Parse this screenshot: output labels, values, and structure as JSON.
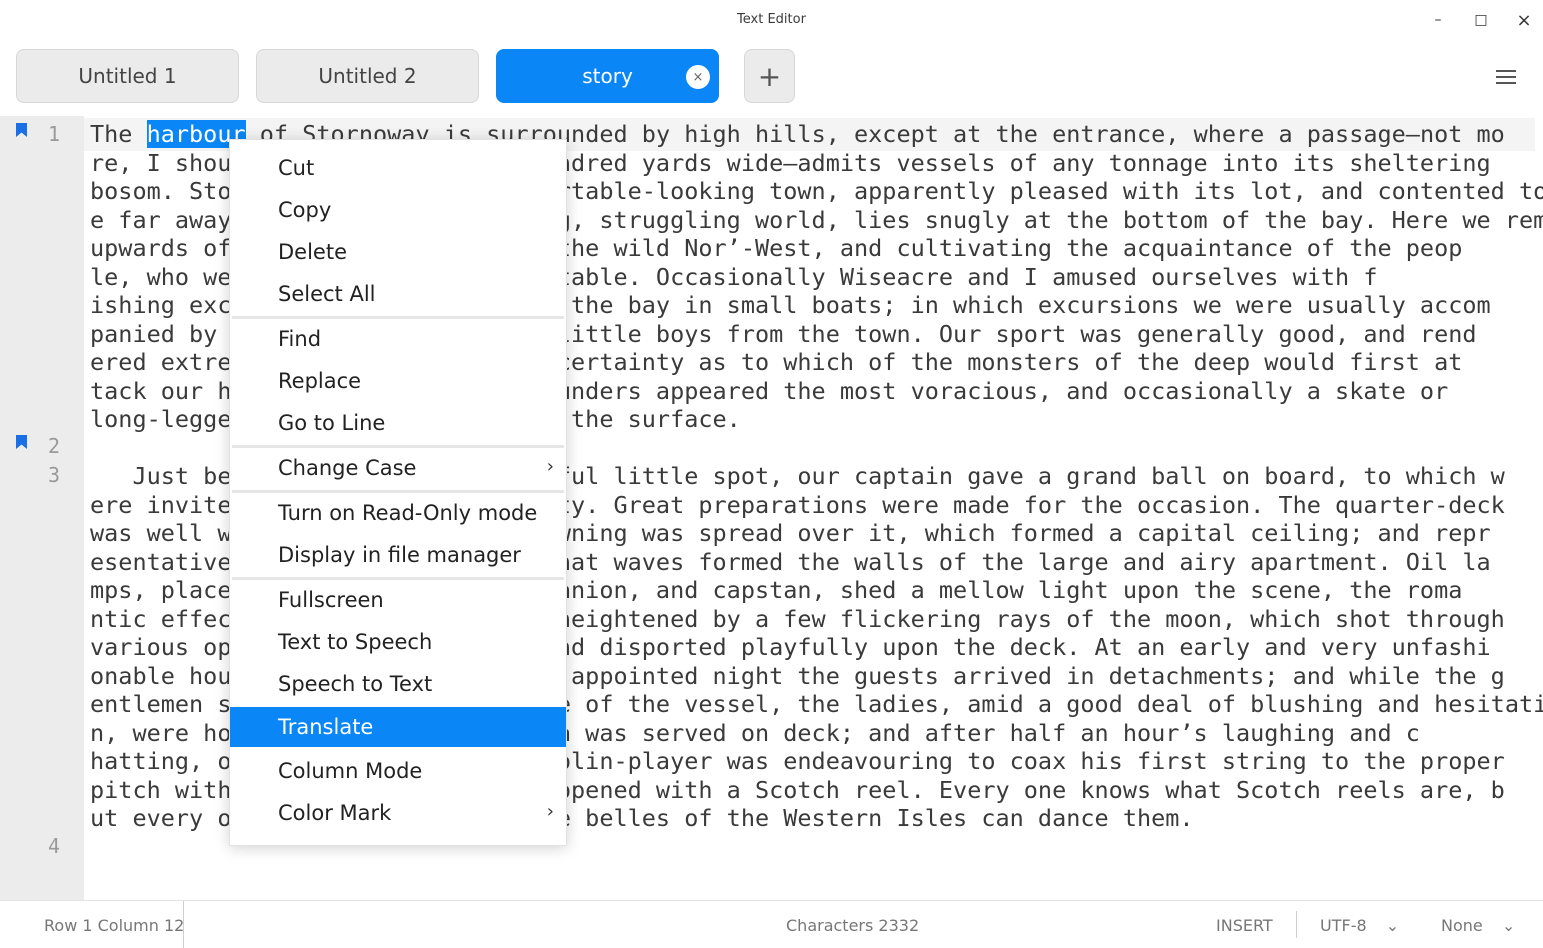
{
  "window": {
    "title": "Text Editor",
    "minimize": "–",
    "maximize": "□",
    "close": "×"
  },
  "tabs": [
    {
      "label": "Untitled 1"
    },
    {
      "label": "Untitled 2"
    },
    {
      "label": "story",
      "active": true,
      "close": "×"
    }
  ],
  "toolbar": {
    "new_tab": "+"
  },
  "editor": {
    "line_numbers": [
      "1",
      "2",
      "3",
      "4"
    ],
    "bookmarked_lines": [
      "1",
      "2"
    ],
    "selected_word": "harbour",
    "lines": [
      "The ",
      " of Stornoway is surrounded by high hills, except at the entrance, where a passage—not mo\nre, I should think, than a few hundred yards wide—admits vessels of any tonnage into its sheltering\nbosom. Stornoway is a neat, comfortable-looking town, apparently pleased with its lot, and contented to b\ne far away from the great bustling, struggling world, lies snugly at the bottom of the bay. Here we remained\nupwards of a week, preparing for the wild Nor’-West, and cultivating the acquaintance of the peop\nle, who we found to be very hospitable. Occasionally Wiseacre and I amused ourselves with f\nishing excursions to the mouth of the bay in small boats; in which excursions we were usually accom\npanied by two or three hardy old little boys from the town. Our sport was generally good, and rend\nered extremely exciting by the uncertainty as to which of the monsters of the deep would first at\ntack our hooks. Flat-fish and flounders appeared the most voracious, and occasionally a skate or\nlong-legged crab would come up to the surface.\n\n   Just before we left this cheerful little spot, our captain gave a grand ball on board, to which w\nere invited all the rank and beauty. Great preparations were made for the occasion. The quarter-deck\nwas well washed, and a spacious awning was spread over it, which formed a capital ceiling; and repr\nesentative flags of all nations that waves formed the walls of the large and airy apartment. Oil la\nmps, placed on the binnacle, companion, and capstan, shed a mellow light upon the scene, the roma\nntic effect of which was greatly heightened by a few flickering rays of the moon, which shot through\nvarious openings in the awning, and disported playfully upon the deck. At an early and very unfashi\nonable hour on the evening of the appointed night the guests arrived in detachments; and while the g\nentlemen stood smoking on the side of the vessel, the ladies, amid a good deal of blushing and hesitatio\nn, were hoisted up in a chair. Tea was served on deck; and after half an hour’s laughing and c\nhatting, our fiddler—a capital violin-player was endeavouring to coax his first string to the proper\npitch with the pipe—and the ball opened with a Scotch reel. Every one knows what Scotch reels are, b\nut every one does not know how the belles of the Western Isles can dance them."
    ]
  },
  "context_menu": {
    "items": [
      {
        "label": "Cut"
      },
      {
        "label": "Copy"
      },
      {
        "label": "Delete"
      },
      {
        "label": "Select All"
      },
      {
        "label": "Find"
      },
      {
        "label": "Replace"
      },
      {
        "label": "Go to Line"
      },
      {
        "label": "Change Case",
        "submenu": "›"
      },
      {
        "label": "Turn on Read-Only mode"
      },
      {
        "label": "Display in file manager"
      },
      {
        "label": "Fullscreen"
      },
      {
        "label": "Text to Speech"
      },
      {
        "label": "Speech to Text"
      },
      {
        "label": "Translate",
        "highlighted": true
      },
      {
        "label": "Column Mode"
      },
      {
        "label": "Color Mark",
        "submenu": "›"
      }
    ]
  },
  "statusbar": {
    "position": "Row 1  Column 12",
    "characters": "Characters 2332",
    "mode": "INSERT",
    "encoding": "UTF-8",
    "highlight": "None",
    "dropdown_arrow": "⌄"
  },
  "colors": {
    "accent": "#0a86f6",
    "gutter": "#ececec",
    "bookmark": "#1a6fe6"
  }
}
